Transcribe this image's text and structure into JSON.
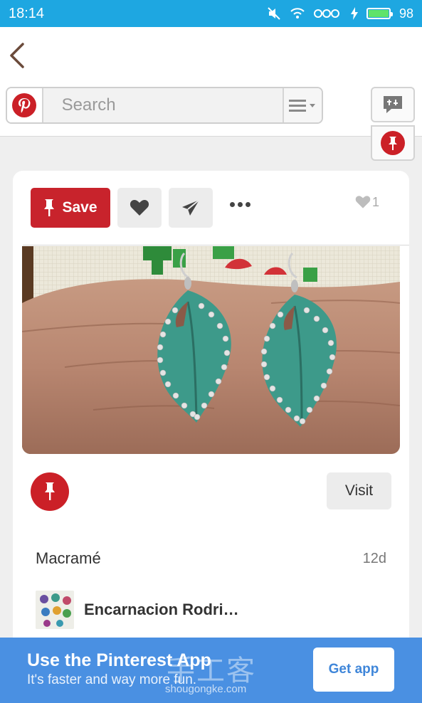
{
  "status_bar": {
    "time": "18:14",
    "battery_level": "98",
    "icons": [
      "mute-icon",
      "wifi-icon",
      "notification-icons",
      "charging-icon",
      "battery-icon"
    ]
  },
  "search": {
    "placeholder": "Search"
  },
  "pin_actions": {
    "save_label": "Save",
    "like_count": "1"
  },
  "pin": {
    "visit_label": "Visit",
    "board_name": "Macramé",
    "age": "12d",
    "owner_name": "Encarnacion Rodri…"
  },
  "app_banner": {
    "title": "Use the Pinterest App",
    "subtitle": "It's faster and way more fun.",
    "button_label": "Get app",
    "watermark": "手工客",
    "watermark_url": "shougongke.com"
  },
  "colors": {
    "status_bar": "#1ea7e1",
    "pinterest_red": "#c8232c",
    "banner_blue": "#4a90e2"
  }
}
